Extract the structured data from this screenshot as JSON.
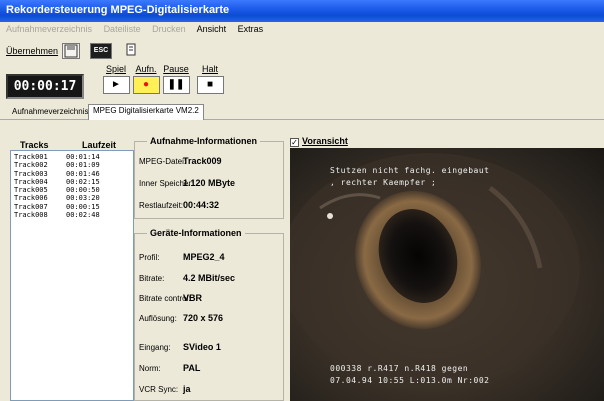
{
  "window": {
    "title": "Rekordersteuerung MPEG-Digitalisierkarte"
  },
  "menu": [
    {
      "label": "Aufnahmeverzeichnis",
      "enabled": false
    },
    {
      "label": "Dateiliste",
      "enabled": false
    },
    {
      "label": "Drucken",
      "enabled": false
    },
    {
      "label": "Ansicht",
      "enabled": true
    },
    {
      "label": "Extras",
      "enabled": true
    }
  ],
  "toolbar": {
    "apply_label": "Übernehmen",
    "icon_badge": "ESC"
  },
  "timecode": "00:00:17",
  "transport": {
    "play": {
      "label": "Spiel",
      "glyph": "►"
    },
    "record": {
      "label": "Aufn.",
      "glyph": "●"
    },
    "pause": {
      "label": "Pause",
      "glyph": "❚❚"
    },
    "stop": {
      "label": "Halt",
      "glyph": "■"
    }
  },
  "tabs": [
    {
      "label": "Aufnahmeverzeichnis",
      "selected": false
    },
    {
      "label": "MPEG Digitalisierkarte VM2.2",
      "selected": true
    }
  ],
  "tracks": {
    "col_track": "Tracks",
    "col_duration": "Laufzeit",
    "rows": [
      {
        "name": "Track001",
        "duration": "00:01:14"
      },
      {
        "name": "Track002",
        "duration": "00:01:09"
      },
      {
        "name": "Track003",
        "duration": "00:01:46"
      },
      {
        "name": "Track004",
        "duration": "00:02:15"
      },
      {
        "name": "Track005",
        "duration": "00:00:50"
      },
      {
        "name": "Track006",
        "duration": "00:03:20"
      },
      {
        "name": "Track007",
        "duration": "00:00:15"
      },
      {
        "name": "Track008",
        "duration": "00:02:48"
      }
    ]
  },
  "recording_info": {
    "title": "Aufnahme-Informationen",
    "file_label": "MPEG-Datei:",
    "file_value": "Track009",
    "memory_label": "Inner Speicher:",
    "memory_value": "1.120 MByte",
    "remaining_label": "Restlaufzeit:",
    "remaining_value": "00:44:32"
  },
  "device_info": {
    "title": "Geräte-Informationen",
    "profile_label": "Profil:",
    "profile_value": "MPEG2_4",
    "bitrate_label": "Bitrate:",
    "bitrate_value": "4.2 MBit/sec",
    "bitrate_control_label": "Bitrate control:",
    "bitrate_control_value": "VBR",
    "resolution_label": "Auflösung:",
    "resolution_value": "720 x 576",
    "input_label": "Eingang:",
    "input_value": "SVideo 1",
    "norm_label": "Norm:",
    "norm_value": "PAL",
    "vcr_label": "VCR Sync:",
    "vcr_value": "ja"
  },
  "preview": {
    "label": "Voransicht",
    "checked": true,
    "overlay_line1": "Stutzen nicht fachg. eingebaut",
    "overlay_line2": ", rechter Kaempfer ;",
    "overlay_bottom1": "000338 r.R417 n.R418 gegen",
    "overlay_bottom2": "07.04.94 10:55 L:013.0m Nr:002"
  }
}
